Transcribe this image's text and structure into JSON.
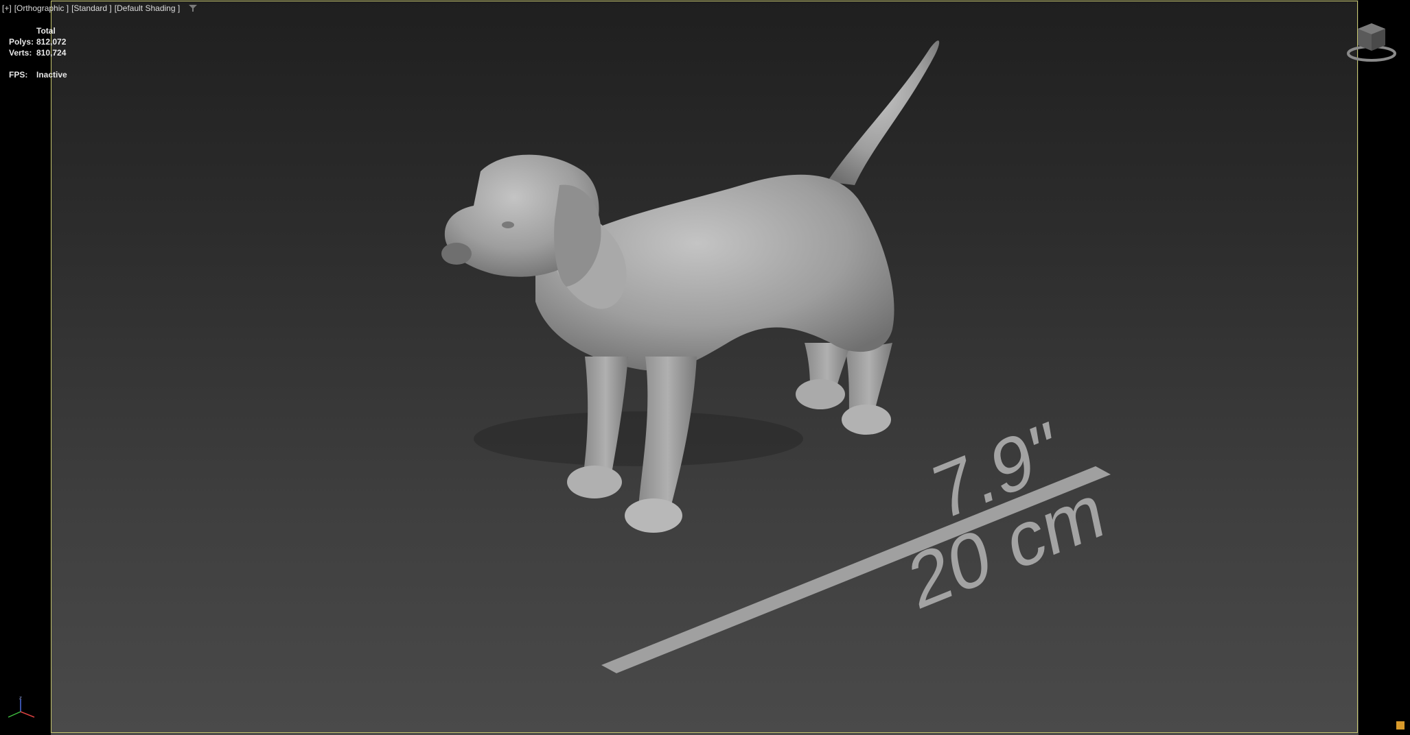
{
  "viewport": {
    "menu": "[+]",
    "view": "[Orthographic ]",
    "style": "[Standard ]",
    "shading": "[Default Shading ]"
  },
  "stats": {
    "header": "Total",
    "polys_label": "Polys:",
    "polys_value": "812,072",
    "verts_label": "Verts:",
    "verts_value": "810,724",
    "fps_label": "FPS:",
    "fps_value": "Inactive"
  },
  "scene": {
    "dimension_inches": "7.9\"",
    "dimension_cm": "20 cm"
  },
  "icons": {
    "filter": "filter-icon",
    "viewcube": "viewcube-icon",
    "axis": "axis-gizmo-icon"
  },
  "colors": {
    "frame_border": "#c8c870",
    "model": "#9a9a9a",
    "dimension": "#a3a3a3"
  }
}
